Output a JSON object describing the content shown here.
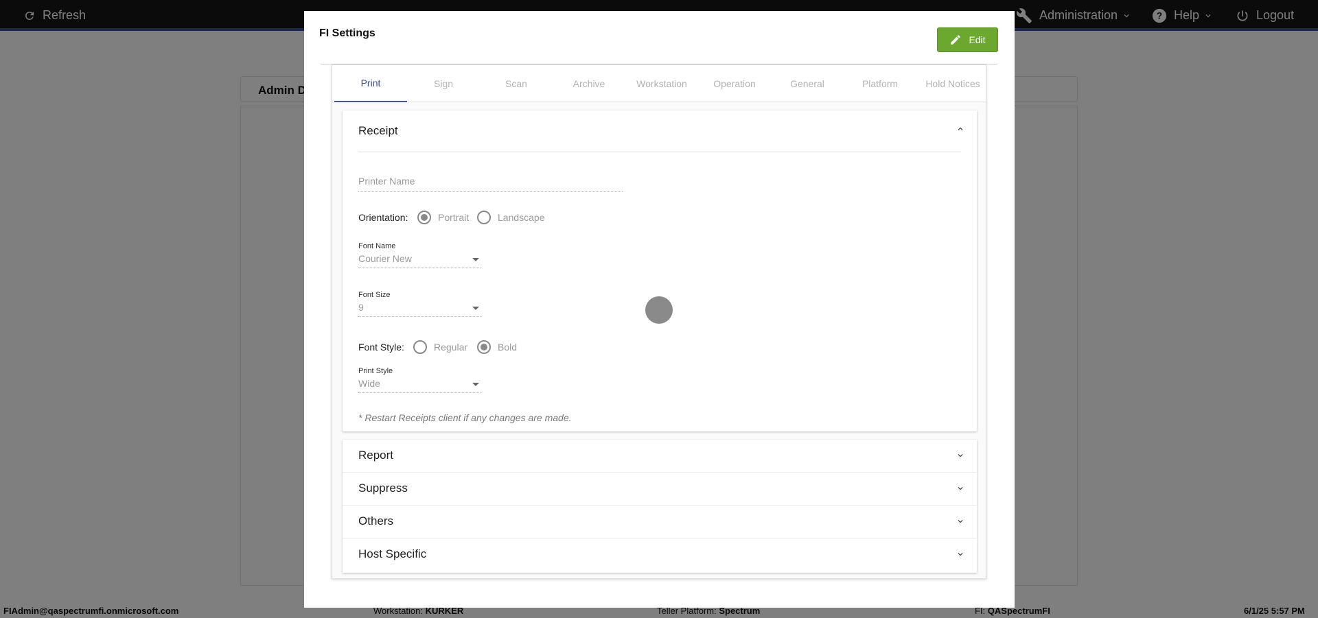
{
  "topbar": {
    "refresh_label": "Refresh",
    "administration_label": "Administration",
    "help_label": "Help",
    "logout_label": "Logout"
  },
  "background": {
    "card_title": "Admin D"
  },
  "footer": {
    "user": "FIAdmin@qaspectrumfi.onmicrosoft.com",
    "workstation_label": "Workstation:",
    "workstation_value": "KURKER",
    "platform_label": "Teller Platform:",
    "platform_value": "Spectrum",
    "fi_label": "FI:",
    "fi_value": "QASpectrumFI",
    "datetime": "6/1/25 5:57 PM"
  },
  "modal": {
    "title": "FI Settings",
    "edit_label": "Edit",
    "tabs": [
      {
        "label": "Print"
      },
      {
        "label": "Sign"
      },
      {
        "label": "Scan"
      },
      {
        "label": "Archive"
      },
      {
        "label": "Workstation"
      },
      {
        "label": "Operation"
      },
      {
        "label": "General"
      },
      {
        "label": "Platform"
      },
      {
        "label": "Hold Notices"
      }
    ],
    "receipt": {
      "title": "Receipt",
      "printer_name_placeholder": "Printer Name",
      "orientation_label": "Orientation:",
      "orientation_options": [
        "Portrait",
        "Landscape"
      ],
      "orientation_selected": "Portrait",
      "font_name_caption": "Font Name",
      "font_name_value": "Courier New",
      "font_size_caption": "Font Size",
      "font_size_value": "9",
      "font_style_label": "Font Style:",
      "font_style_options": [
        "Regular",
        "Bold"
      ],
      "font_style_selected": "Bold",
      "print_style_caption": "Print Style",
      "print_style_value": "Wide",
      "note": "* Restart Receipts client if any changes are made."
    },
    "sections": [
      {
        "title": "Report"
      },
      {
        "title": "Suppress"
      },
      {
        "title": "Others"
      },
      {
        "title": "Host Specific"
      }
    ]
  },
  "colors": {
    "topbar_bg": "#161616",
    "accent_blue": "#3f51b5",
    "edit_green": "#6aa82e"
  },
  "icons": {
    "refresh": "refresh-icon",
    "administration": "wrench-icon",
    "help": "help-circle-icon",
    "logout": "power-icon",
    "edit": "pencil-icon"
  }
}
